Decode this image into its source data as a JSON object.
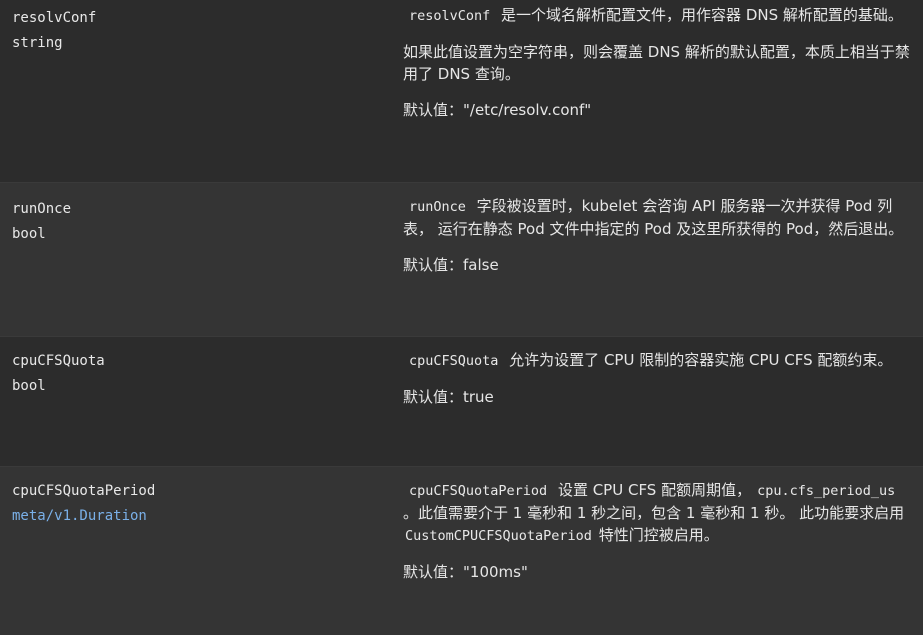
{
  "rows": [
    {
      "name": "resolvConf",
      "type": "string",
      "p1_code": "resolvConf",
      "p1_text": " 是一个域名解析配置文件，用作容器 DNS 解析配置的基础。",
      "p2": "如果此值设置为空字符串，则会覆盖 DNS 解析的默认配置，本质上相当于禁用了 DNS 查询。",
      "default": "默认值：\"/etc/resolv.conf\""
    },
    {
      "name": "runOnce",
      "type": "bool",
      "p1_code": "runOnce",
      "p1_text": " 字段被设置时，kubelet 会咨询 API 服务器一次并获得 Pod 列表， 运行在静态 Pod 文件中指定的 Pod 及这里所获得的 Pod，然后退出。",
      "default": "默认值：false"
    },
    {
      "name": "cpuCFSQuota",
      "type": "bool",
      "p1_code": "cpuCFSQuota",
      "p1_text": " 允许为设置了 CPU 限制的容器实施 CPU CFS 配额约束。",
      "default": "默认值：true"
    },
    {
      "name": "cpuCFSQuotaPeriod",
      "type": "meta/v1.Duration",
      "p1_code": "cpuCFSQuotaPeriod",
      "p1_text_a": " 设置 CPU CFS 配额周期值，",
      "p1_code2": "cpu.cfs_period_us",
      "p1_text_b": " 。此值需要介于 1 毫秒和 1 秒之间，包含 1 毫秒和 1 秒。 此功能要求启用 ",
      "p1_code3": "CustomCPUCFSQuotaPeriod",
      "p1_text_c": " 特性门控被启用。",
      "default": "默认值：\"100ms\""
    }
  ]
}
